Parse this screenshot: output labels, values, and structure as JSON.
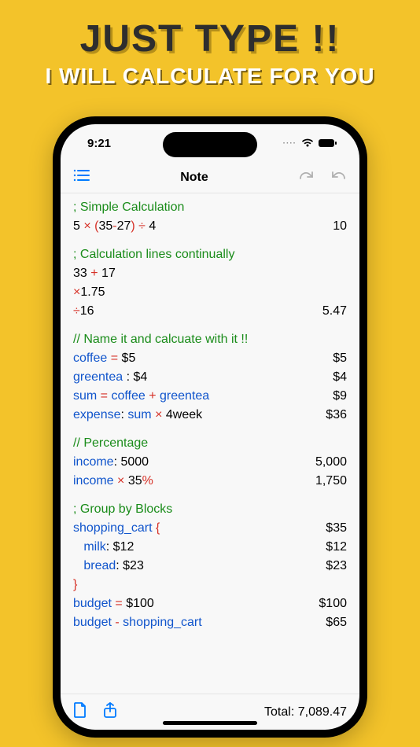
{
  "hero": {
    "line1": "JUST TYPE !!",
    "line2": "I WILL CALCULATE FOR YOU"
  },
  "status": {
    "time": "9:21"
  },
  "nav": {
    "title": "Note"
  },
  "sections": {
    "s1_cmt": "; Simple Calculation",
    "s1_line1_a": "5 ",
    "s1_line1_b": "× ",
    "s1_line1_c": "(",
    "s1_line1_d": "35",
    "s1_line1_e": "-",
    "s1_line1_f": "27",
    "s1_line1_g": ")",
    "s1_line1_h": " ÷ ",
    "s1_line1_i": "4",
    "s1_line1_res": "10",
    "s2_cmt": "; Calculation lines continually",
    "s2_l1_a": "33 ",
    "s2_l1_b": "+ ",
    "s2_l1_c": "17",
    "s2_l2_a": "×",
    "s2_l2_b": "1.75",
    "s2_l3_a": "÷",
    "s2_l3_b": "16",
    "s2_l3_res": "5.47",
    "s3_cmt": "// Name it and calcuate with it !!",
    "s3_l1_a": "coffee ",
    "s3_l1_b": "= ",
    "s3_l1_c": "$5",
    "s3_l1_res": "$5",
    "s3_l2_a": "greentea ",
    "s3_l2_b": ": $4",
    "s3_l2_res": "$4",
    "s3_l3_a": "sum ",
    "s3_l3_b": "= ",
    "s3_l3_c": "coffee ",
    "s3_l3_d": "+ ",
    "s3_l3_e": "greentea",
    "s3_l3_res": "$9",
    "s3_l4_a": "expense",
    "s3_l4_b": ": ",
    "s3_l4_c": "sum ",
    "s3_l4_d": "× ",
    "s3_l4_e": "4week",
    "s3_l4_res": "$36",
    "s4_cmt": "// Percentage",
    "s4_l1_a": "income",
    "s4_l1_b": ": 5000",
    "s4_l1_res": "5,000",
    "s4_l2_a": "income ",
    "s4_l2_b": "× ",
    "s4_l2_c": "35",
    "s4_l2_d": "%",
    "s4_l2_res": "1,750",
    "s5_cmt": "; Group by Blocks",
    "s5_l1_a": "shopping_cart ",
    "s5_l1_b": "{",
    "s5_l1_res": "$35",
    "s5_l2_a": "   milk",
    "s5_l2_b": ": $12",
    "s5_l2_res": "$12",
    "s5_l3_a": "   bread",
    "s5_l3_b": ": $23",
    "s5_l3_res": "$23",
    "s5_l4_a": "}",
    "s5_l5_a": "budget ",
    "s5_l5_b": "= ",
    "s5_l5_c": "$100",
    "s5_l5_res": "$100",
    "s5_l6_a": "budget ",
    "s5_l6_b": "- ",
    "s5_l6_c": "shopping_cart",
    "s5_l6_res": "$65"
  },
  "footer": {
    "total_label": "Total: 7,089.47"
  }
}
